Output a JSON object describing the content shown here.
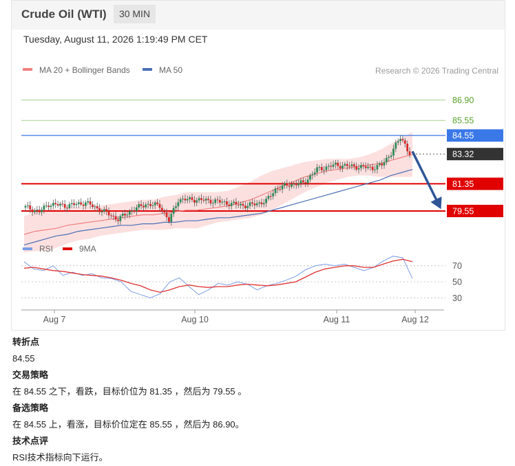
{
  "header": {
    "title": "Crude Oil (WTI)",
    "timeframe": "30 MIN"
  },
  "timestamp": "Tuesday, August 11, 2026 1:19:49 PM CET",
  "legend": {
    "ma20": "MA 20 + Bollinger Bands",
    "ma50": "MA 50",
    "credit": "Research © 2026 Trading Central"
  },
  "rsi_legend": {
    "rsi": "RSI",
    "ma9": "9MA"
  },
  "colors": {
    "ma20": "#f08080",
    "ma50": "#4a6fb5",
    "bands": "#fbd5d5",
    "resistance": "#a9d18e",
    "pivot": "#5b8de8",
    "support": "#e00000",
    "up": "#2e8b57",
    "down": "#d62828",
    "arrow": "#2f5597"
  },
  "chart_data": [
    {
      "type": "candlestick",
      "title": "Crude Oil (WTI)",
      "ylim": [
        78,
        88.2
      ],
      "x_ticks": [
        "Aug 7",
        "Aug 10",
        "Aug 11",
        "Aug 12"
      ],
      "levels": [
        {
          "value": 86.9,
          "label": "86.90",
          "kind": "resistance"
        },
        {
          "value": 85.55,
          "label": "85.55",
          "kind": "resistance"
        },
        {
          "value": 84.55,
          "label": "84.55",
          "kind": "pivot"
        },
        {
          "value": 83.32,
          "label": "83.32",
          "kind": "last"
        },
        {
          "value": 81.35,
          "label": "81.35",
          "kind": "support"
        },
        {
          "value": 79.55,
          "label": "79.55",
          "kind": "support"
        }
      ],
      "series": [
        {
          "name": "MA 20 + Bollinger Bands",
          "values": [
            78.0,
            78.2,
            78.3,
            78.4,
            78.6,
            78.7,
            78.8,
            78.9,
            79.0,
            79.1,
            79.2,
            79.3,
            79.3,
            79.4,
            79.5,
            79.6,
            79.6,
            79.7,
            79.8,
            79.9,
            80.1,
            80.3,
            80.6,
            80.9,
            81.2,
            81.5,
            81.8,
            82.0,
            82.2,
            82.3,
            82.4,
            82.5,
            82.6,
            82.7,
            82.9,
            83.1,
            83.3
          ]
        },
        {
          "name": "MA 50",
          "values": [
            77.3,
            77.5,
            77.7,
            77.9,
            78.0,
            78.2,
            78.3,
            78.4,
            78.5,
            78.6,
            78.6,
            78.7,
            78.7,
            78.8,
            78.8,
            78.9,
            78.9,
            79.0,
            79.1,
            79.1,
            79.2,
            79.3,
            79.4,
            79.6,
            79.8,
            80.0,
            80.2,
            80.4,
            80.6,
            80.8,
            81.0,
            81.2,
            81.4,
            81.6,
            81.9,
            82.1,
            82.3
          ]
        }
      ]
    },
    {
      "type": "line",
      "title": "RSI",
      "ylim": [
        20,
        80
      ],
      "y_ticks": [
        70,
        50,
        30
      ],
      "series": [
        {
          "name": "RSI",
          "values": [
            75,
            66,
            64,
            70,
            58,
            62,
            58,
            60,
            55,
            54,
            50,
            38,
            34,
            30,
            35,
            50,
            55,
            44,
            34,
            40,
            48,
            46,
            50,
            47,
            40,
            45,
            48,
            52,
            57,
            65,
            70,
            72,
            70,
            72,
            68,
            64,
            68,
            76,
            82,
            80,
            54
          ]
        },
        {
          "name": "9MA",
          "values": [
            67,
            68,
            66,
            64,
            63,
            61,
            59,
            58,
            57,
            55,
            52,
            48,
            45,
            40,
            37,
            40,
            44,
            46,
            44,
            43,
            44,
            44,
            46,
            47,
            46,
            45,
            46,
            48,
            50,
            56,
            62,
            66,
            68,
            70,
            70,
            68,
            68,
            72,
            76,
            78,
            75
          ]
        }
      ]
    }
  ],
  "analysis": {
    "pivot_heading": "转折点",
    "pivot_value": "84.55",
    "strategy_heading": "交易策略",
    "strategy_text": "在 84.55 之下，看跌，目标价位为 81.35 ，然后为 79.55 。",
    "alt_heading": "备选策略",
    "alt_text": "在 84.55 上，看涨，目标价位定在 85.55 ，然后为 86.90。",
    "comment_heading": "技术点评",
    "comment_text": "RSI技术指标向下运行。"
  }
}
